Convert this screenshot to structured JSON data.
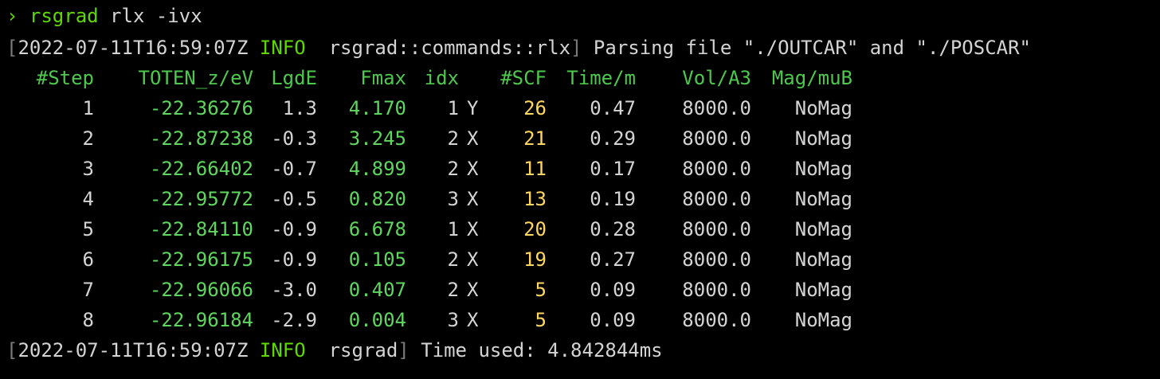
{
  "prompt": {
    "symbol": "›",
    "command": "rsgrad",
    "args": " rlx -ivx"
  },
  "log_start": {
    "timestamp": "2022-07-11T16:59:07Z",
    "level": "INFO",
    "module": "rsgrad::commands::rlx",
    "message": " Parsing file \"./OUTCAR\" and \"./POSCAR\""
  },
  "table": {
    "headers": [
      "#Step",
      "TOTEN_z/eV",
      "LgdE",
      "Fmax",
      "idx",
      "#SCF",
      "Time/m",
      "Vol/A3",
      "Mag/muB"
    ],
    "rows": [
      {
        "step": "1",
        "toten": "-22.36276",
        "lgde": "1.3",
        "fmax": "4.170",
        "idx": "1",
        "axis": "Y",
        "scf": "26",
        "time": "0.47",
        "vol": "8000.0",
        "mag": "NoMag"
      },
      {
        "step": "2",
        "toten": "-22.87238",
        "lgde": "-0.3",
        "fmax": "3.245",
        "idx": "2",
        "axis": "X",
        "scf": "21",
        "time": "0.29",
        "vol": "8000.0",
        "mag": "NoMag"
      },
      {
        "step": "3",
        "toten": "-22.66402",
        "lgde": "-0.7",
        "fmax": "4.899",
        "idx": "2",
        "axis": "X",
        "scf": "11",
        "time": "0.17",
        "vol": "8000.0",
        "mag": "NoMag"
      },
      {
        "step": "4",
        "toten": "-22.95772",
        "lgde": "-0.5",
        "fmax": "0.820",
        "idx": "3",
        "axis": "X",
        "scf": "13",
        "time": "0.19",
        "vol": "8000.0",
        "mag": "NoMag"
      },
      {
        "step": "5",
        "toten": "-22.84110",
        "lgde": "-0.9",
        "fmax": "6.678",
        "idx": "1",
        "axis": "X",
        "scf": "20",
        "time": "0.28",
        "vol": "8000.0",
        "mag": "NoMag"
      },
      {
        "step": "6",
        "toten": "-22.96175",
        "lgde": "-0.9",
        "fmax": "0.105",
        "idx": "2",
        "axis": "X",
        "scf": "19",
        "time": "0.27",
        "vol": "8000.0",
        "mag": "NoMag"
      },
      {
        "step": "7",
        "toten": "-22.96066",
        "lgde": "-3.0",
        "fmax": "0.407",
        "idx": "2",
        "axis": "X",
        "scf": "5",
        "time": "0.09",
        "vol": "8000.0",
        "mag": "NoMag"
      },
      {
        "step": "8",
        "toten": "-22.96184",
        "lgde": "-2.9",
        "fmax": "0.004",
        "idx": "3",
        "axis": "X",
        "scf": "5",
        "time": "0.09",
        "vol": "8000.0",
        "mag": "NoMag"
      }
    ]
  },
  "log_end": {
    "timestamp": "2022-07-11T16:59:07Z",
    "level": "INFO",
    "module": "rsgrad",
    "message": " Time used: 4.842844ms"
  },
  "colors": {
    "background": "#000000",
    "foreground": "#d4d4d4",
    "green": "#5fd75f",
    "yellow": "#ffd75f",
    "bracket": "#7a7a7a"
  }
}
